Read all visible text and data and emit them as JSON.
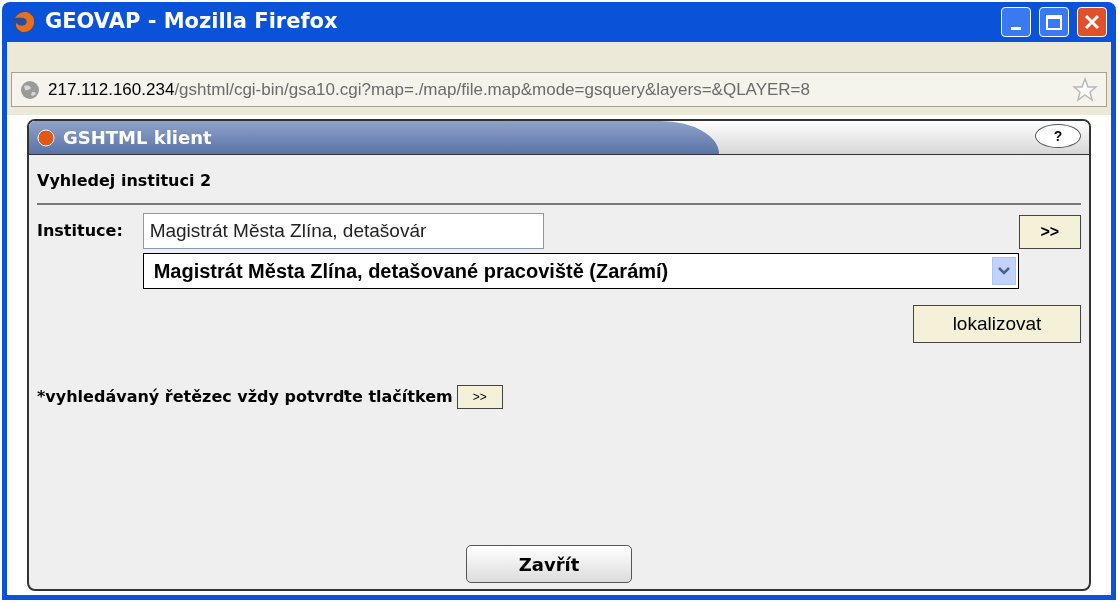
{
  "window": {
    "title": "GEOVAP - Mozilla Firefox"
  },
  "address_bar": {
    "host": "217.112.160.234",
    "path": "/gshtml/cgi-bin/gsa10.cgi?map=./map/file.map&mode=gsquery&layers=&QLAYER=8"
  },
  "panel": {
    "title": "GSHTML klient",
    "help": "?"
  },
  "form": {
    "heading": "Vyhledej instituci 2",
    "label": "Instituce:",
    "input_value": "Magistrát Města Zlína, detašovár",
    "search_button": ">>",
    "select_value": "Magistrát Města Zlína, detašované pracoviště (Zarámí)",
    "locate_button": "lokalizovat",
    "hint": "*vyhledávaný řetězec vždy potvrďte tlačítkem",
    "hint_button": ">>",
    "close_button": "Zavřít"
  }
}
